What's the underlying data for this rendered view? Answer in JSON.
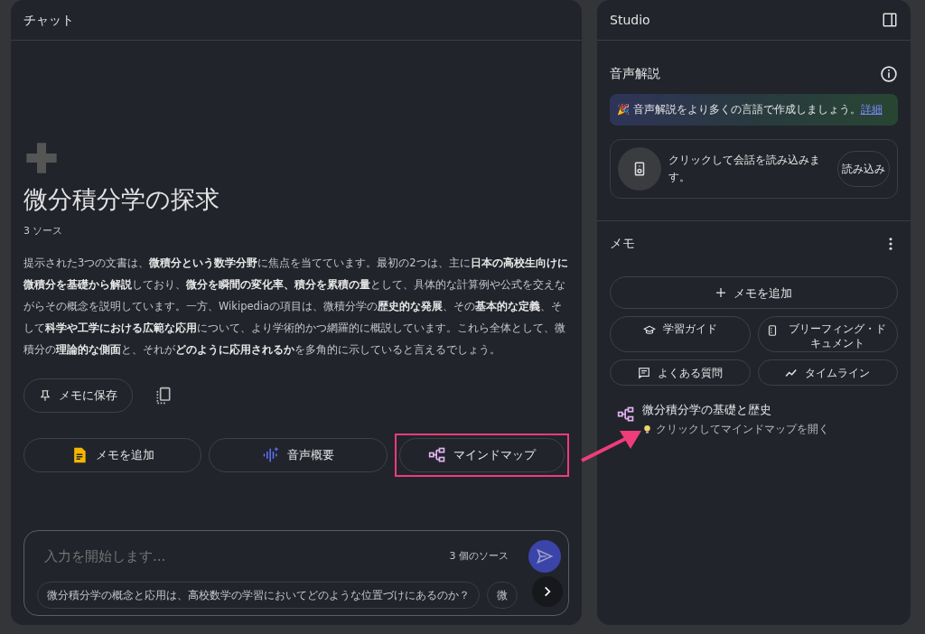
{
  "chat": {
    "title": "チャット",
    "notebook_title": "微分積分学の探求",
    "source_count": "3 ソース",
    "summary": "提示された3つの文書は、**微積分という数学分野**に焦点を当てています。最初の2つは、主に**日本の高校生向けに微積分を基礎から解説**しており、**微分を瞬間の変化率、積分を累積の量**として、具体的な計算例や公式を交えながらその概念を説明しています。一方、Wikipediaの項目は、微積分学の**歴史的な発展**、その**基本的な定義**、そして**科学や工学における広範な応用**について、より学術的かつ網羅的に概説しています。これら全体として、微積分の**理論的な側面**と、それが**どのように応用されるか**を多角的に示していると言えるでしょう。",
    "save_button": "メモに保存",
    "actions": [
      {
        "kind": "memo",
        "label": "メモを追加",
        "highlighted": false
      },
      {
        "kind": "audio",
        "label": "音声概要",
        "highlighted": false
      },
      {
        "kind": "mindmap",
        "label": "マインドマップ",
        "highlighted": true
      }
    ],
    "input": {
      "placeholder": "入力を開始します...",
      "source_count": "3 個のソース"
    },
    "suggestions": [
      "微分積分学の概念と応用は、高校数学の学習においてどのような位置づけにあるのか？",
      "微"
    ]
  },
  "studio": {
    "title": "Studio",
    "audio": {
      "title": "音声解説",
      "banner": "🎉 音声解説をより多くの言語で作成しましょう。",
      "banner_link": "詳細",
      "load_text": "クリックして会話を読み込みます。",
      "load_button": "読み込み"
    },
    "notes": {
      "title": "メモ",
      "add_button": "メモを追加",
      "tools": [
        {
          "kind": "study",
          "label": "学習ガイド"
        },
        {
          "kind": "briefing",
          "label": "ブリーフィング・ドキュメント"
        },
        {
          "kind": "faq",
          "label": "よくある質問"
        },
        {
          "kind": "timeline",
          "label": "タイムライン"
        }
      ],
      "items": [
        {
          "title": "微分積分学の基礎と歴史",
          "hint": "クリックしてマインドマップを開く"
        }
      ]
    }
  }
}
